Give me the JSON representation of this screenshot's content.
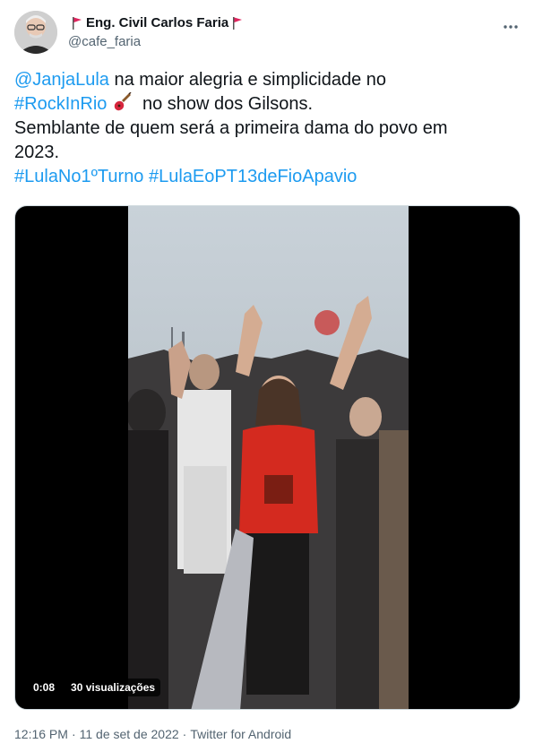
{
  "author": {
    "display_name": "Eng. Civil Carlos Faria",
    "handle": "@cafe_faria",
    "flag_color": "#e0245e"
  },
  "tweet": {
    "mention": "@JanjaLula",
    "line1_rest": " na maior alegria e simplicidade no",
    "hashtag_rockinrio": "#RockInRio",
    "line2_rest": " no show dos Gilsons.",
    "line3": "Semblante de quem será a primeira dama do povo em",
    "line4": "2023.",
    "hashtag_lula_turno": "#LulaNo1ºTurno",
    "hashtag_lula_pt": "#LulaEoPT13deFioApavio",
    "link_color": "#1d9bf0"
  },
  "video": {
    "duration": "0:08",
    "views": "30 visualizações"
  },
  "footer": {
    "time": "12:16 PM",
    "date": "11 de set de 2022",
    "source": "Twitter for Android",
    "separator": "·"
  },
  "icons": {
    "more": "more-horizontal-icon",
    "flag": "red-flag-icon",
    "guitar": "guitar-emoji-icon"
  }
}
